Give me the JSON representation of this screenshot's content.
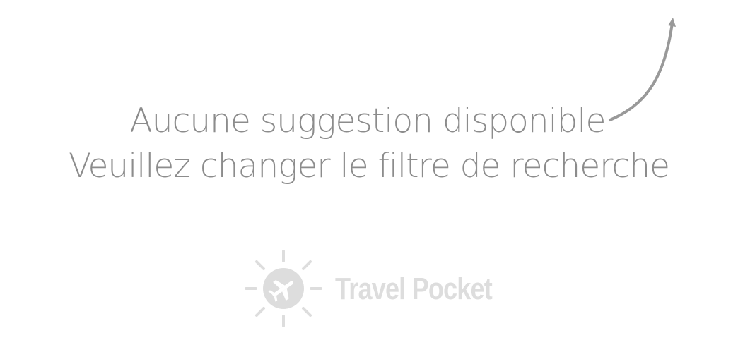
{
  "empty_state": {
    "title": "Aucune suggestion disponible",
    "subtitle": "Veuillez changer le filtre de recherche"
  },
  "brand": {
    "name": "Travel Pocket",
    "logo_icon": "sun-airplane-icon"
  },
  "colors": {
    "message_text": "#8c8c8c",
    "arrow": "#999999",
    "brand": "#dddddd"
  }
}
